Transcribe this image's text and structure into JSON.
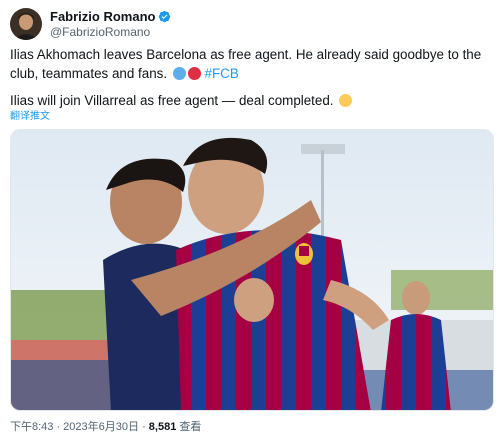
{
  "tweet": {
    "author": {
      "name": "Fabrizio Romano",
      "handle": "@FabrizioRomano",
      "verified": true
    },
    "paragraph1_text": "Ilias Akhomach leaves Barcelona as free agent. He already said goodbye to the club, teammates and fans.",
    "paragraph1_emoji": [
      "blue-circle",
      "red-circle"
    ],
    "hashtag": "#FCB",
    "paragraph2_text": "Ilias will join Villarreal as free agent — deal completed.",
    "paragraph2_emoji": [
      "yellow-circle"
    ],
    "translate_label": "翻译推文",
    "timestamp": "下午8:43 · 2023年6月30日 · ",
    "views_count": "8,581",
    "views_label": " 查看"
  },
  "colors": {
    "link": "#1d9bf0",
    "emoji_blue": "#5dadec",
    "emoji_red": "#dd2e44",
    "emoji_yellow": "#fdcb58",
    "kit_blue": "#1c3f94",
    "kit_garnet": "#a50044"
  }
}
